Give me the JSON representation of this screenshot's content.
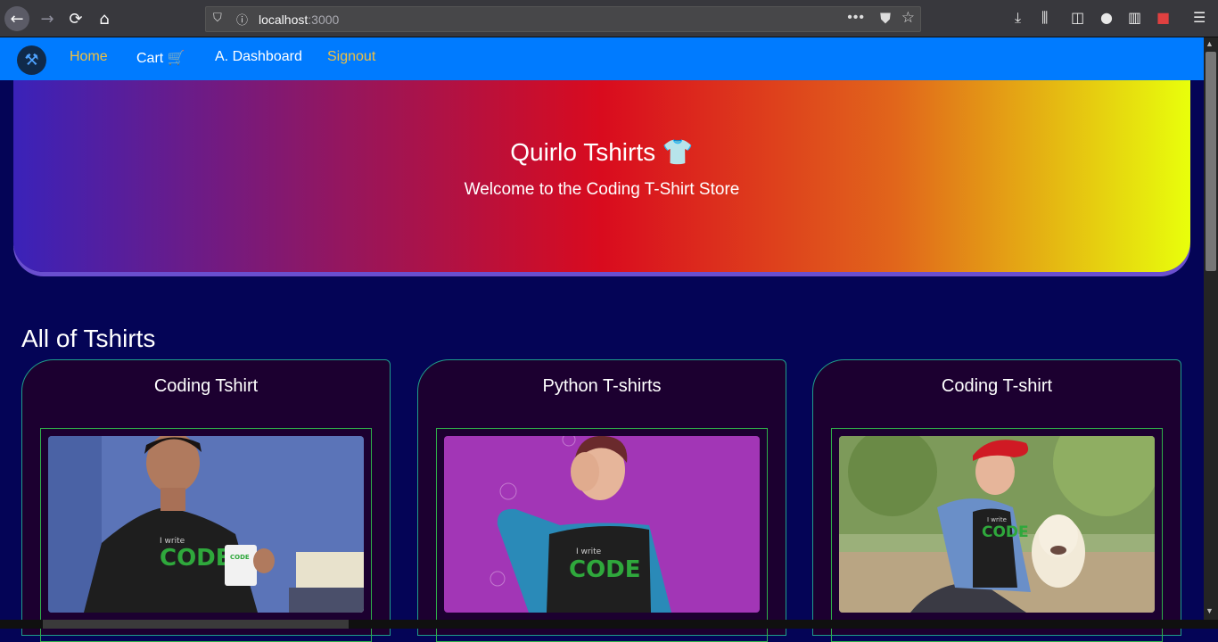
{
  "browser": {
    "url_host": "localhost",
    "url_port": ":3000"
  },
  "navbar": {
    "links": [
      {
        "label": "Home"
      },
      {
        "label": "Cart 🛒"
      },
      {
        "label": "A. Dashboard"
      },
      {
        "label": "Signout"
      }
    ]
  },
  "hero": {
    "title": "Quirlo Tshirts 👕",
    "subtitle": "Welcome to the Coding T-Shirt Store"
  },
  "main": {
    "section_title": "All of Tshirts",
    "products": [
      {
        "title": "Coding Tshirt",
        "shirt_text_small": "I write",
        "shirt_text_big": "CODE"
      },
      {
        "title": "Python T-shirts",
        "shirt_text_small": "I write",
        "shirt_text_big": "CODE"
      },
      {
        "title": "Coding T-shirt",
        "shirt_text_small": "I write",
        "shirt_text_big": "CODE"
      }
    ]
  },
  "colors": {
    "navbar": "#007bff",
    "page_bg": "#040456",
    "card_bg": "#1c0030",
    "card_border": "#1f9d8a"
  }
}
